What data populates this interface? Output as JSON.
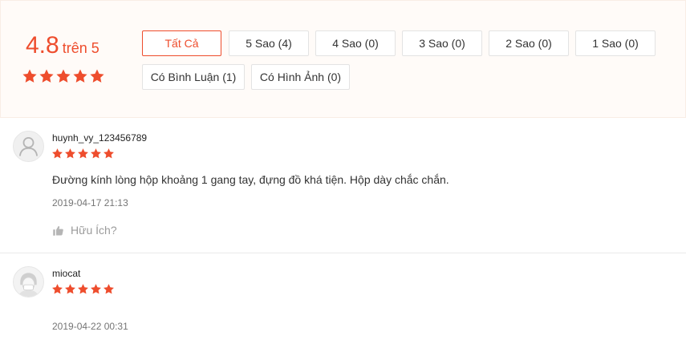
{
  "overview": {
    "score": "4.8",
    "score_suffix": "trên 5",
    "star_count": 5
  },
  "filters": {
    "all": "Tất Cả",
    "five_star": "5 Sao (4)",
    "four_star": "4 Sao (0)",
    "three_star": "3 Sao (0)",
    "two_star": "2 Sao (0)",
    "one_star": "1 Sao (0)",
    "with_comment": "Có Bình Luận (1)",
    "with_images": "Có Hình Ảnh (0)"
  },
  "reviews": [
    {
      "username": "huynh_vy_123456789",
      "rating": 5,
      "comment": "Đường kính lòng hộp khoảng 1 gang tay, đựng đồ khá tiện. Hộp dày chắc chắn.",
      "timestamp": "2019-04-17 21:13",
      "helpful_label": "Hữu Ích?"
    },
    {
      "username": "miocat",
      "rating": 5,
      "timestamp": "2019-04-22 00:31"
    }
  ],
  "colors": {
    "accent": "#ee4d2d",
    "overview_background": "#fffbf8"
  },
  "icons": {
    "star": "star-icon",
    "default_avatar": "default-avatar-icon",
    "thumbs_up": "thumbs-up-icon"
  }
}
